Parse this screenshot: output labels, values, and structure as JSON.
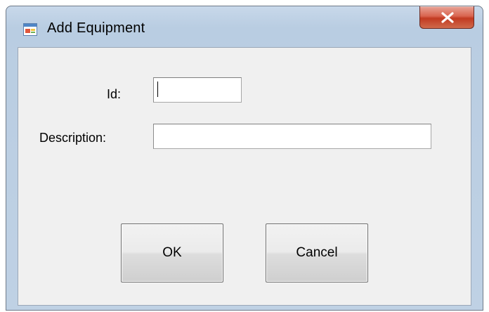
{
  "window": {
    "title": "Add Equipment",
    "app_icon": "windows-form-icon",
    "close_icon": "close-x-icon"
  },
  "form": {
    "id_label": "Id:",
    "id_value": "",
    "description_label": "Description:",
    "description_value": ""
  },
  "buttons": {
    "ok_label": "OK",
    "cancel_label": "Cancel"
  },
  "colors": {
    "title_bar": "#c8d8ea",
    "client_background": "#f0f0f0",
    "close_button": "#c23a22"
  }
}
